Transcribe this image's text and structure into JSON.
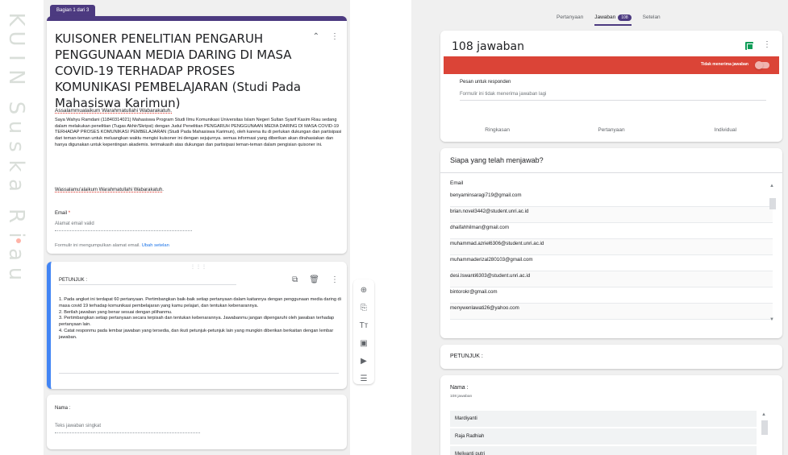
{
  "watermark": {
    "letters": [
      "K",
      "U",
      "I",
      "N",
      "S",
      "u",
      "s",
      "k",
      "a",
      "R",
      "i",
      "a",
      "u"
    ]
  },
  "left": {
    "section_tab": "Bagian 1 dari 3",
    "form_title": "KUISONER PENELITIAN PENGARUH PENGGUNAAN MEDIA DARING DI MASA COVID-19 TERHADAP PROSES KOMUNIKASI PEMBELAJARAN (Studi Pada Mahasiswa Karimun)",
    "greeting": "Assalammualaikum Warahmatullahi Wabarakatuh.",
    "intro": "Saya Wahyu Ramdani (11840314021) Mahasiswa Program Studi Ilmu Komunikasi Universitas Islam Negeri Sultan Syarif Kasim Riau sedang dalam melakukan penelitian (Tugas Akhir/Skripsi) dengan Judul Penelitian PENGARUH PENGGUNAAN MEDIA DARING DI MASA COVID-19 TERHADAP PROSES KOMUNIKASI PEMBELAJARAN (Studi Pada Mahasiswa Karimun), oleh karena itu di perlukan dukungan dan partisipasi dari teman-teman untuk meluangkan waktu mengisi kuisoner ini dengan sejujurnya. semua informasi yang diberikan akan dirahasiakan dan hanya digunakan untuk kepentingan akademis. terimakasih atas dukungan dan partisipasi teman-teman dalam pengisian quisoner ini.",
    "closing": "Wassalamu'alaikum Warahmatullahi Wabarakatuh.",
    "email_label": "Email",
    "email_required": "*",
    "email_placeholder": "Alamat email valid",
    "email_note": "Formulir ini mengumpulkan alamat email.",
    "email_note_link": "Ubah setelan",
    "petunjuk_label": "PETUNJUK :",
    "petunjuk_lines": [
      "1. Pada angket ini terdapat 60 pertanyaan. Pertimbangkan baik-baik setiap pertanyaan dalam kaitannya dengan penggunaan media daring di masa covid 19 terhadap komunikasi pembelajaran yang kamu pelajari, dan tentukan kebenarannya.",
      "2. Berilah jawaban yang benar sesuai dengan pilihanmu.",
      "3. Pertimbangkan setiap pertanyaan secara terpisah dan tentukan kebenarannya. Jawabanmu jangan dipengaruhi oleh jawaban terhadap pertanyaan lain.",
      "4. Catat responmu pada lembar jawaban yang tersedia, dan ikuti petunjuk-petunjuk lain yang mungkin diberikan berkaitan dengan lembar jawaban."
    ],
    "nama_label": "Nama :",
    "nama_placeholder": "Teks jawaban singkat"
  },
  "right": {
    "tabs": {
      "questions": "Pertanyaan",
      "responses": "Jawaban",
      "responses_badge": "108",
      "settings": "Setelan"
    },
    "response_count": "108 jawaban",
    "not_accepting": "Tidak menerima jawaban",
    "msg_title": "Pesan untuk responden",
    "msg_value": "Formulir ini tidak menerima jawaban lagi",
    "subtabs": {
      "summary": "Ringkasan",
      "question": "Pertanyaan",
      "individual": "Individual"
    },
    "who_title": "Siapa yang telah menjawab?",
    "email_header": "Email",
    "emails": [
      "benyaminsaragi719@gmail.com",
      "brian.novel3442@student.unri.ac.id",
      "dhaifahhilman@gmail.com",
      "muhammad.azriel6306@student.unri.ac.id",
      "muhammaderizal280103@gmail.com",
      "desi.lswanti6303@student.unri.ac.id",
      "bintorokr@gmail.com",
      "menywenlawati26@yahoo.com"
    ],
    "petunjuk_label": "PETUNJUK :",
    "nama_label": "Nama :",
    "nama_count": "108 jawaban",
    "names": [
      "Mardiyanti",
      "Raja Radhiah",
      "Meliyanti putri"
    ]
  }
}
